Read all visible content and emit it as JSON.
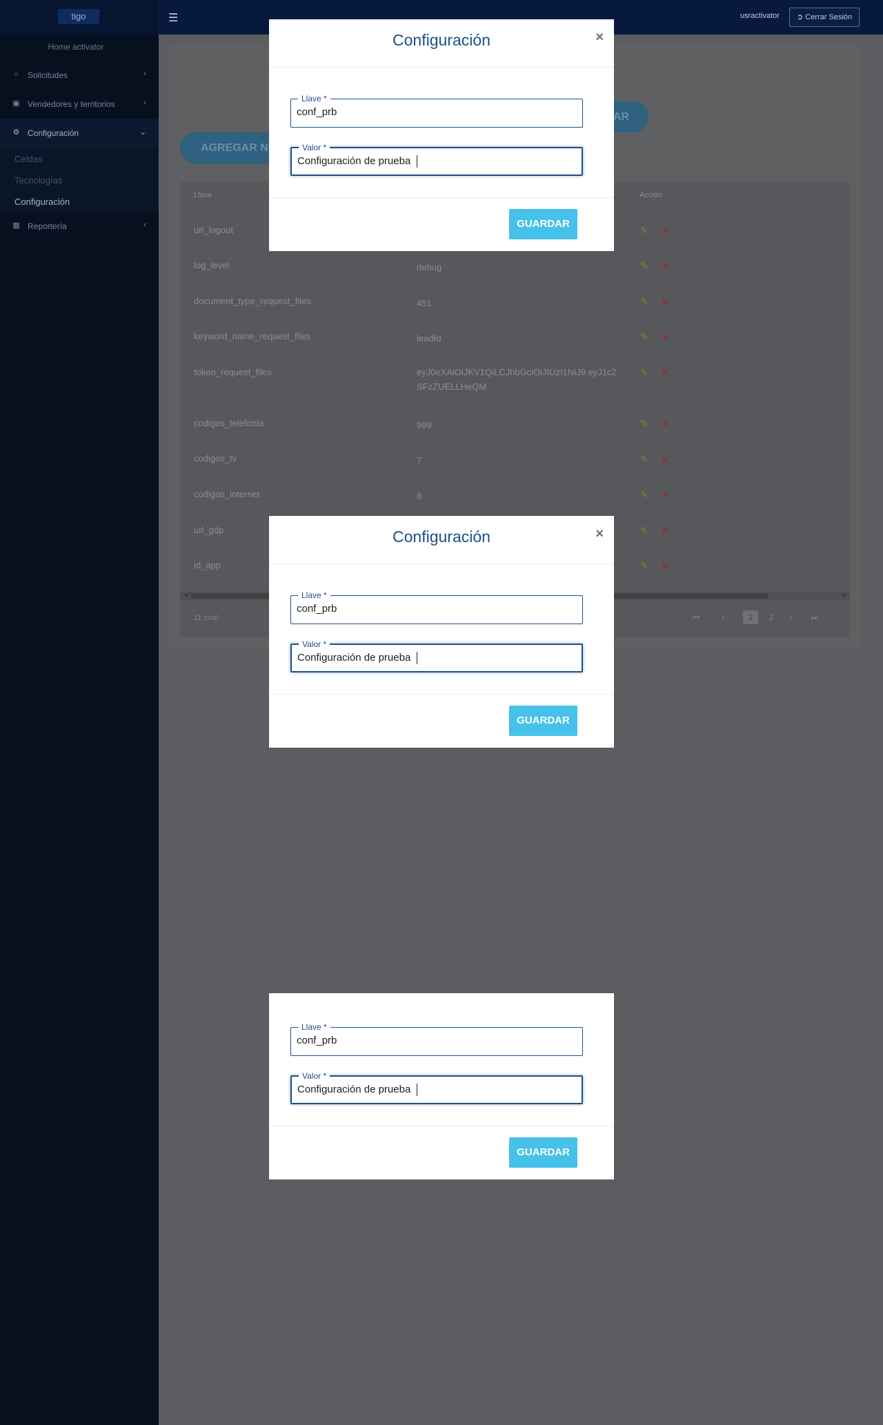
{
  "topbar": {
    "logo_text": "tigo",
    "menu_icon": "hamburger-icon",
    "username": "usractivator",
    "logout_label": "Cerrar Sesión",
    "logout_icon": "sign-out-icon"
  },
  "sidebar": {
    "home_label": "Home activator",
    "items": [
      {
        "label": "Solicitudes",
        "icon": "circle-icon"
      },
      {
        "label": "Vendedores y territorios",
        "icon": "contact-card-icon"
      },
      {
        "label": "Configuración",
        "icon": "gears-icon"
      },
      {
        "label": "Reportería",
        "icon": "bar-chart-icon"
      }
    ],
    "sub_items": [
      "Celdas",
      "Tecnologías",
      "Configuración"
    ]
  },
  "content": {
    "add_button_label": "AGREGAR NU",
    "search_button_label": "AR",
    "table": {
      "col_key": "Llave",
      "col_action": "Acción",
      "rows": [
        {
          "key": "url_logout",
          "value": ""
        },
        {
          "key": "log_level",
          "value": "debug"
        },
        {
          "key": "document_type_request_files",
          "value": "451"
        },
        {
          "key": "keyword_name_request_files",
          "value": "leadId"
        },
        {
          "key": "token_request_files",
          "value": "eyJ0eXAiOiJKV1QiLCJhbGciOiJIUzI1NiJ9.eyJ1c2",
          "value2": "SFzZUELLHeQM"
        },
        {
          "key": "codigos_telefonia",
          "value": "999"
        },
        {
          "key": "codigos_tv",
          "value": "7"
        },
        {
          "key": "codigos_internet",
          "value": "8"
        },
        {
          "key": "url_gdp",
          "value": ""
        },
        {
          "key": "id_app",
          "value": ""
        }
      ],
      "total_label": "11 total",
      "pages": [
        "1",
        "2"
      ]
    }
  },
  "modal": {
    "title": "Configuración",
    "close_symbol": "×",
    "key_label": "Llave *",
    "key_value": "conf_prb",
    "value_label": "Valor *",
    "value_value": "Configuración de prueba",
    "save_label": "GUARDAR"
  },
  "colors": {
    "topbar": "#071a3e",
    "sidebar": "#06101f",
    "backdrop": "#5b5d60",
    "accent": "#1b4f8a",
    "save_button": "#46c1ea"
  }
}
